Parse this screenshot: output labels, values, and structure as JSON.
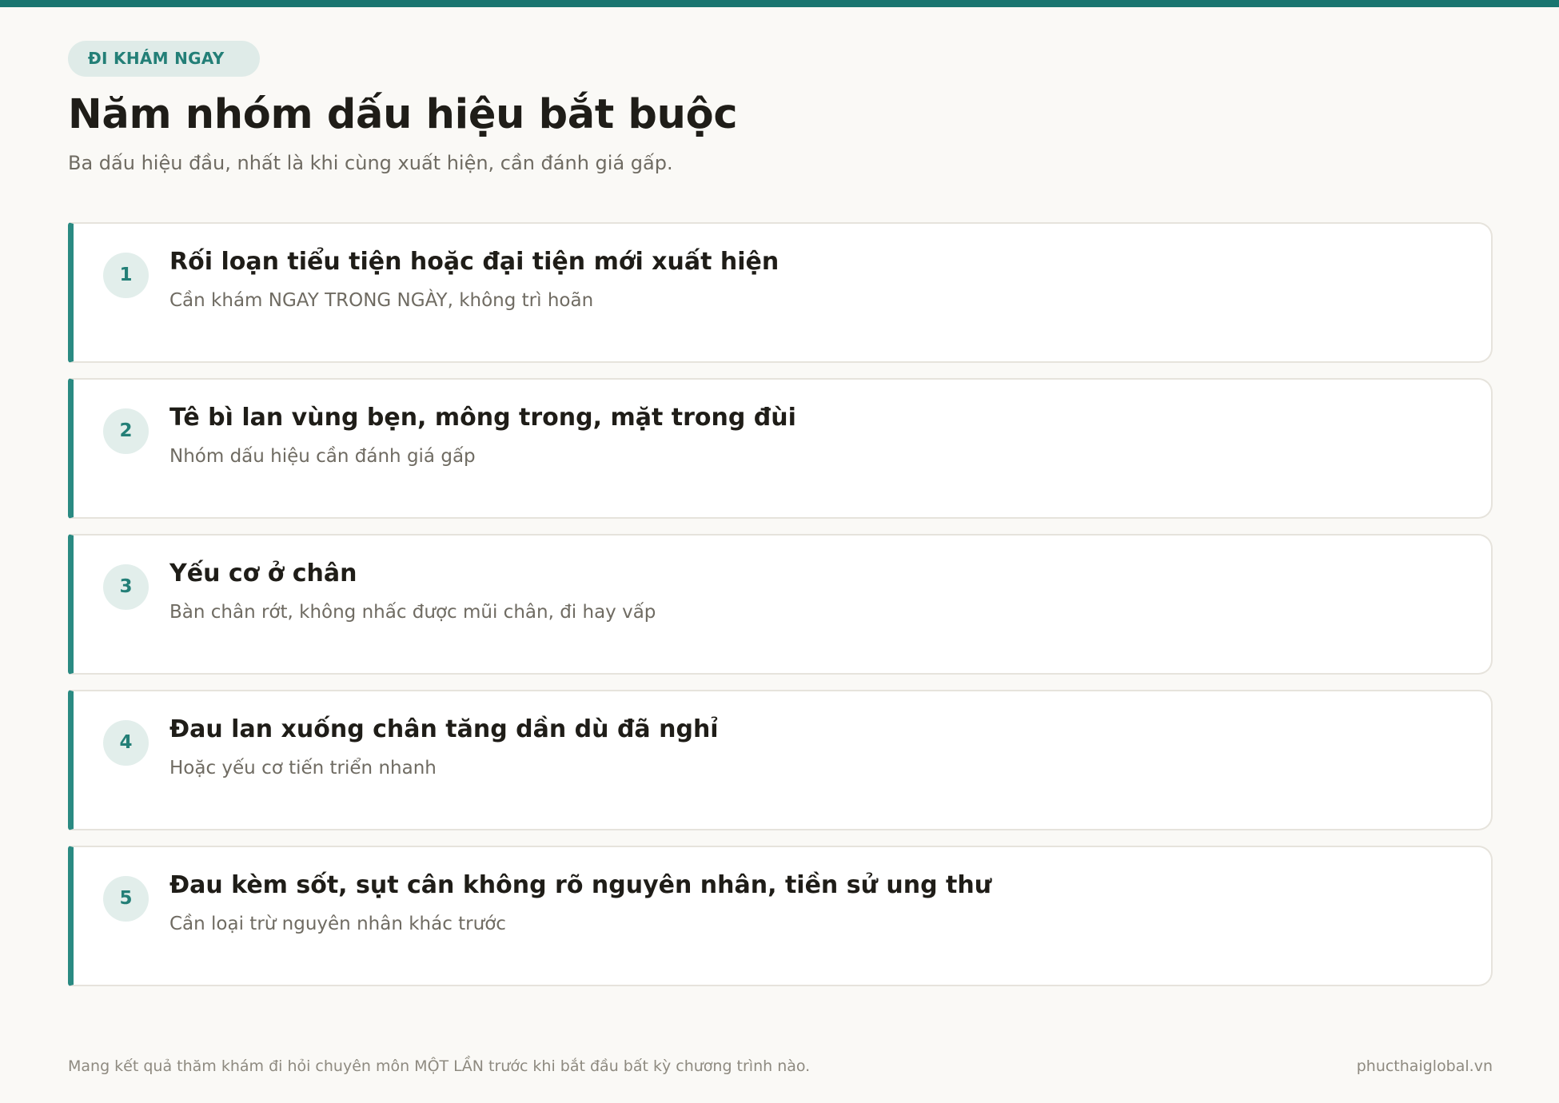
{
  "badge": "ĐI KHÁM NGAY",
  "title": "Năm nhóm dấu hiệu bắt buộc",
  "subtitle": "Ba dấu hiệu đầu, nhất là khi cùng xuất hiện, cần đánh giá gấp.",
  "cards": [
    {
      "number": "1",
      "title": "Rối loạn tiểu tiện hoặc đại tiện mới xuất hiện",
      "desc": "Cần khám NGAY TRONG NGÀY, không trì hoãn"
    },
    {
      "number": "2",
      "title": "Tê bì lan vùng bẹn, mông trong, mặt trong đùi",
      "desc": "Nhóm dấu hiệu cần đánh giá gấp"
    },
    {
      "number": "3",
      "title": "Yếu cơ ở chân",
      "desc": "Bàn chân rớt, không nhấc được mũi chân, đi hay vấp"
    },
    {
      "number": "4",
      "title": "Đau lan xuống chân tăng dần dù đã nghỉ",
      "desc": "Hoặc yếu cơ tiến triển nhanh"
    },
    {
      "number": "5",
      "title": "Đau kèm sốt, sụt cân không rõ nguyên nhân, tiền sử ung thư",
      "desc": "Cần loại trừ nguyên nhân khác trước"
    }
  ],
  "footer": {
    "note": "Mang kết quả thăm khám đi hỏi chuyên môn MỘT LẦN trước khi bắt đầu bất kỳ chương trình nào.",
    "site": "phucthaiglobal.vn"
  },
  "colors": {
    "accent": "#1a7570",
    "card_border_accent": "#2a8a82",
    "badge_bg": "#dfebe8",
    "background": "#faf9f6"
  }
}
